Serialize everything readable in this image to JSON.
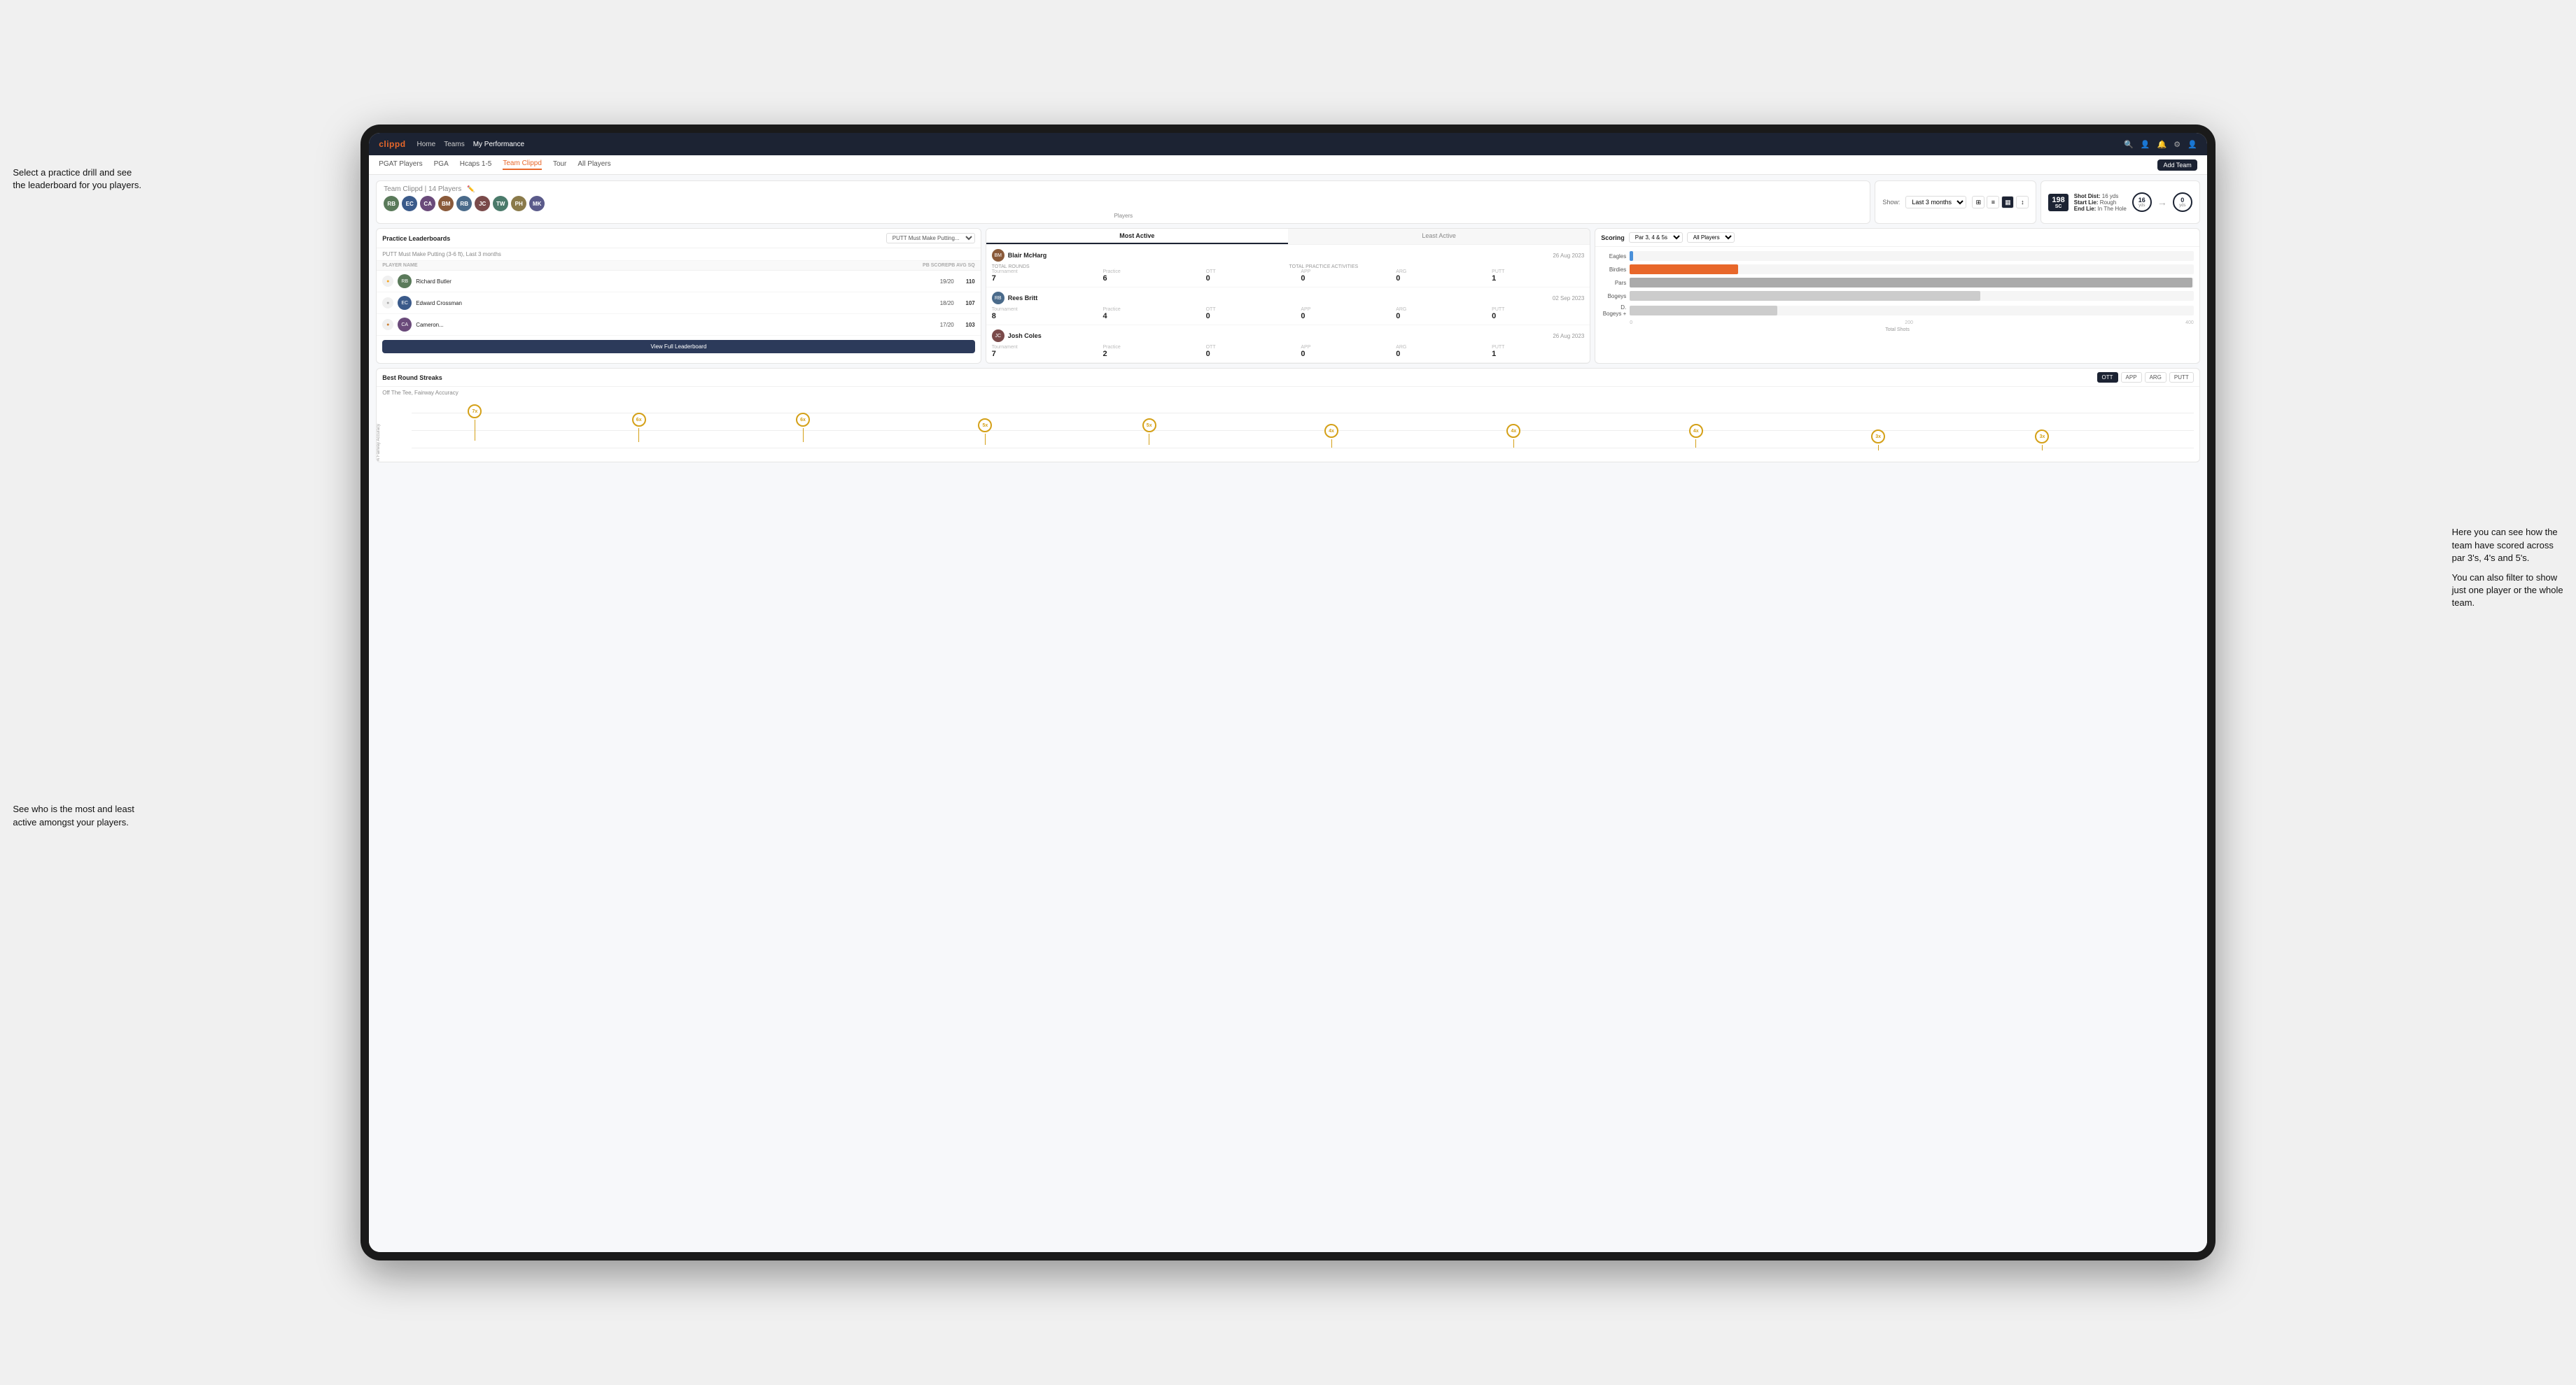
{
  "annotations": {
    "top_left": "Select a practice drill and see\nthe leaderboard for you players.",
    "bottom_left": "See who is the most and least\nactive amongst your players.",
    "bottom_right_title": "Here you can see how the\nteam have scored across\npar 3's, 4's and 5's.",
    "bottom_right_sub": "You can also filter to show\njust one player or the whole\nteam."
  },
  "nav": {
    "logo": "clippd",
    "links": [
      "Home",
      "Teams",
      "My Performance"
    ],
    "icons": [
      "🔍",
      "👤",
      "🔔",
      "⚙",
      "👤"
    ]
  },
  "sub_nav": {
    "links": [
      "PGAT Players",
      "PGA",
      "Hcaps 1-5",
      "Team Clippd",
      "Tour",
      "All Players"
    ],
    "active": "Team Clippd",
    "add_team": "Add Team"
  },
  "team_header": {
    "title": "Team Clippd",
    "count": "14 Players",
    "show_label": "Show:",
    "show_value": "Last 3 months"
  },
  "shot_card": {
    "badge": "198",
    "badge_sub": "SC",
    "shot_dist_label": "Shot Dist:",
    "shot_dist_val": "16 yds",
    "start_lie_label": "Start Lie:",
    "start_lie_val": "Rough",
    "end_lie_label": "End Lie:",
    "end_lie_val": "In The Hole",
    "dist1": "16",
    "dist1_label": "yds",
    "dist2": "0",
    "dist2_label": "yds"
  },
  "practice_leaderboards": {
    "title": "Practice Leaderboards",
    "drill_name": "PUTT Must Make Putting...",
    "subtitle": "PUTT Must Make Putting (3-6 ft), Last 3 months",
    "col_player": "PLAYER NAME",
    "col_score": "PB SCORE",
    "col_avg": "PB AVG SQ",
    "players": [
      {
        "rank": 1,
        "medal": "🥇",
        "name": "Richard Butler",
        "score": "19/20",
        "avg": "110"
      },
      {
        "rank": 2,
        "medal": "🥈",
        "name": "Edward Crossman",
        "score": "18/20",
        "avg": "107"
      },
      {
        "rank": 3,
        "medal": "🥉",
        "name": "Cameron...",
        "score": "17/20",
        "avg": "103"
      }
    ],
    "view_full": "View Full Leaderboard"
  },
  "activity": {
    "tabs": [
      "Most Active",
      "Least Active"
    ],
    "active_tab": "Most Active",
    "players": [
      {
        "name": "Blair McHarg",
        "date": "26 Aug 2023",
        "total_rounds_label": "Total Rounds",
        "tournament_label": "Tournament",
        "practice_label": "Practice",
        "tournament_val": "7",
        "practice_val": "6",
        "total_practice_label": "Total Practice Activities",
        "ott_label": "OTT",
        "app_label": "APP",
        "arg_label": "ARG",
        "putt_label": "PUTT",
        "ott_val": "0",
        "app_val": "0",
        "arg_val": "0",
        "putt_val": "1"
      },
      {
        "name": "Rees Britt",
        "date": "02 Sep 2023",
        "total_rounds_label": "Total Rounds",
        "tournament_label": "Tournament",
        "practice_label": "Practice",
        "tournament_val": "8",
        "practice_val": "4",
        "total_practice_label": "Total Practice Activities",
        "ott_label": "OTT",
        "app_label": "APP",
        "arg_label": "ARG",
        "putt_label": "PUTT",
        "ott_val": "0",
        "app_val": "0",
        "arg_val": "0",
        "putt_val": "0"
      },
      {
        "name": "Josh Coles",
        "date": "26 Aug 2023",
        "total_rounds_label": "Total Rounds",
        "tournament_label": "Tournament",
        "practice_label": "Practice",
        "tournament_val": "7",
        "practice_val": "2",
        "total_practice_label": "Total Practice Activities",
        "ott_label": "OTT",
        "app_label": "APP",
        "arg_label": "ARG",
        "putt_label": "PUTT",
        "ott_val": "0",
        "app_val": "0",
        "arg_val": "0",
        "putt_val": "1"
      }
    ]
  },
  "scoring": {
    "title": "Scoring",
    "filter1": "Par 3, 4 & 5s",
    "filter2": "All Players",
    "bars": [
      {
        "label": "Eagles",
        "value": 3,
        "max": 500,
        "color": "#4a90d9"
      },
      {
        "label": "Birdies",
        "value": 96,
        "max": 500,
        "color": "#e8672a"
      },
      {
        "label": "Pars",
        "value": 499,
        "max": 500,
        "color": "#aaa"
      },
      {
        "label": "Bogeys",
        "value": 311,
        "max": 500,
        "color": "#c5c5c5"
      },
      {
        "label": "D. Bogeys +",
        "value": 131,
        "max": 500,
        "color": "#e0e0e0"
      }
    ],
    "axis_labels": [
      "0",
      "200",
      "400"
    ],
    "total_label": "Total Shots"
  },
  "streaks": {
    "title": "Best Round Streaks",
    "tabs": [
      "OTT",
      "APP",
      "ARG",
      "PUTT"
    ],
    "active_tab": "OTT",
    "subtitle": "Off The Tee, Fairway Accuracy",
    "y_axis_label": "% Fairway Accuracy",
    "dots": [
      {
        "x": 8,
        "label": "7x"
      },
      {
        "x": 17,
        "label": "6x"
      },
      {
        "x": 26,
        "label": "6x"
      },
      {
        "x": 36,
        "label": "5x"
      },
      {
        "x": 45,
        "label": "5x"
      },
      {
        "x": 55,
        "label": "4x"
      },
      {
        "x": 64,
        "label": "4x"
      },
      {
        "x": 73,
        "label": "4x"
      },
      {
        "x": 82,
        "label": "3x"
      },
      {
        "x": 91,
        "label": "3x"
      }
    ]
  },
  "all_players_filter": "All Players"
}
